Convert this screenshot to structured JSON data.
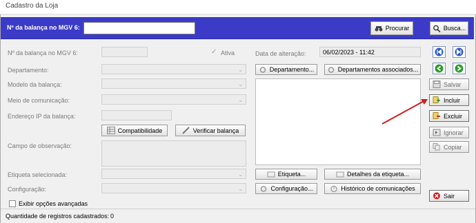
{
  "window": {
    "title": "Cadastro da Loja"
  },
  "header": {
    "label": "Nº da balança no MGV 6:",
    "input_value": "",
    "procurar": "Procurar",
    "busca": "Busca..."
  },
  "form": {
    "numero_label": "Nº da balança no MGV 6:",
    "numero_value": "",
    "ativa_label": "Ativa",
    "departamento_label": "Departamento:",
    "modelo_label": "Modelo da balança:",
    "meio_label": "Meio de comunicação:",
    "ip_label": "Endereço IP da balança:",
    "compat_button": "Compatibilidade",
    "verificar_button": "Verificar balança",
    "obs_label": "Campo de observação:",
    "etiqueta_label": "Etiqueta selecionada:",
    "config_label": "Configuração:",
    "avancadas_label": "Exibir opções avançadas"
  },
  "middle": {
    "data_label": "Data de alteração:",
    "data_value": "06/02/2023 - 11:42",
    "departamento_button": "Departamento...",
    "dep_associados_button": "Departamentos associados...",
    "etiqueta_button": "Etiqueta...",
    "detalhes_button": "Detalhes da etiqueta...",
    "configuracao_button": "Configuração...",
    "historico_button": "Histórico de comunicações"
  },
  "side": {
    "salvar": "Salvar",
    "incluir": "Incluir",
    "excluir": "Excluir",
    "ignorar": "Ignorar",
    "copiar": "Copiar",
    "sair": "Sair"
  },
  "status": {
    "label": "Quantidade de registros cadastrados:",
    "count": "0"
  },
  "colors": {
    "header_bar": "#3b3bc8",
    "annotation_arrow": "#cc1f1f"
  }
}
